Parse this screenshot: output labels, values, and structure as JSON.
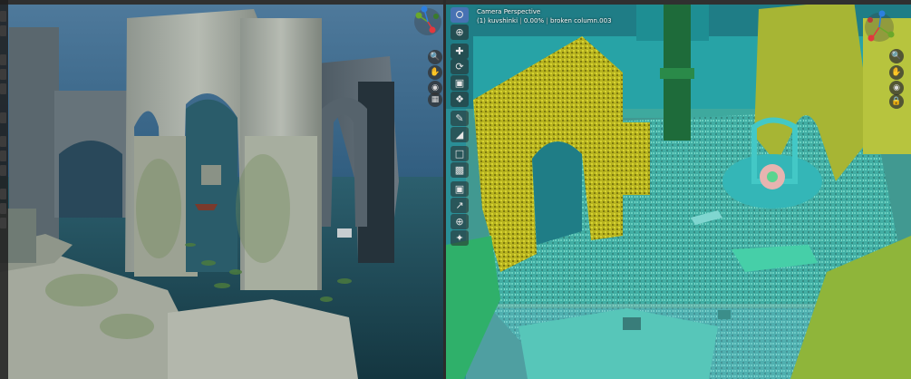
{
  "viewport_right": {
    "view_name": "Camera Perspective",
    "object_info": {
      "frame": "(1)",
      "collection": "kuvshinki",
      "progress": "0.00%",
      "active_object": "broken column.003"
    }
  },
  "colors": {
    "accent": "#4772b3",
    "gizmo_x": "#e2383e",
    "gizmo_y": "#6aa82a",
    "gizmo_z": "#2d7fe0",
    "selection_yellow": "#b8b41f",
    "selection_cyan": "#2fbfbf"
  },
  "icons": {
    "left_nav": [
      "zoom-icon",
      "hand-icon",
      "camera-icon",
      "grid-icon"
    ],
    "right_tools": [
      "select-box-icon",
      "cursor-icon",
      "move-icon",
      "rotate-icon",
      "scale-icon",
      "transform-icon",
      "annotate-icon",
      "measure-icon",
      "add-cube-icon",
      "extrude-icon",
      "inset-icon",
      "bevel-icon",
      "loopcut-icon",
      "knife-icon",
      "poly-build-icon",
      "spin-icon"
    ],
    "right_nav": [
      "zoom-icon",
      "hand-icon",
      "camera-icon",
      "lock-icon"
    ]
  }
}
